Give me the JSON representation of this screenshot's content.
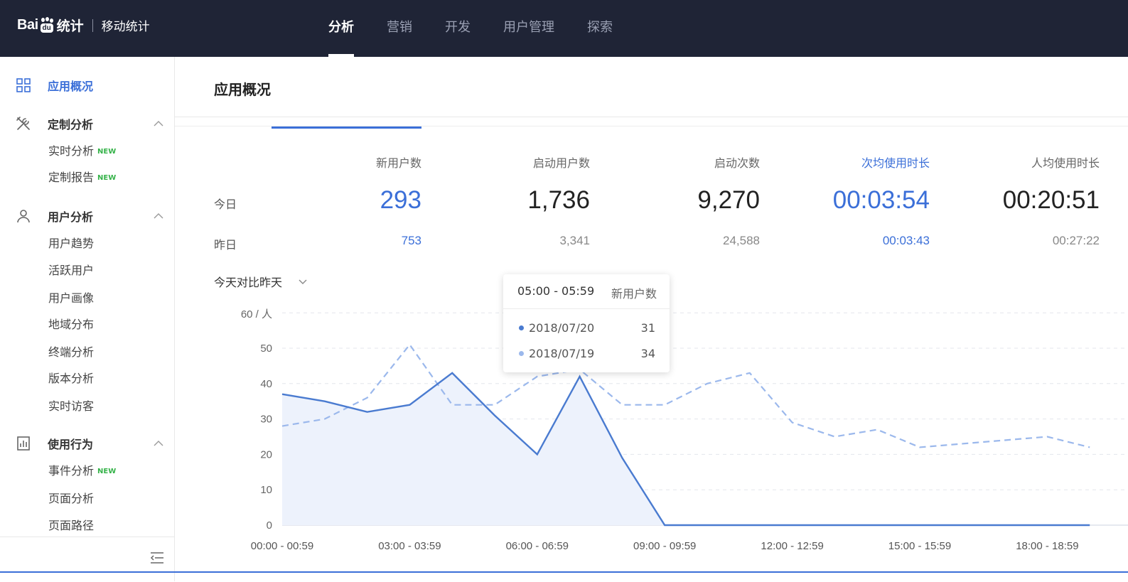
{
  "brand": {
    "logo_pre": "Bai",
    "logo_paw": "du",
    "logo_stat": "统计",
    "product": "移动统计"
  },
  "nav": [
    {
      "label": "分析",
      "active": true
    },
    {
      "label": "营销"
    },
    {
      "label": "开发"
    },
    {
      "label": "用户管理"
    },
    {
      "label": "探索"
    }
  ],
  "sidebar": {
    "overview": {
      "label": "应用概况",
      "icon": "grid-icon"
    },
    "groups": [
      {
        "label": "定制分析",
        "icon": "tools-icon",
        "items": [
          {
            "label": "实时分析",
            "badge": "NEW"
          },
          {
            "label": "定制报告",
            "badge": "NEW"
          }
        ]
      },
      {
        "label": "用户分析",
        "icon": "user-icon",
        "items": [
          {
            "label": "用户趋势"
          },
          {
            "label": "活跃用户"
          },
          {
            "label": "用户画像"
          },
          {
            "label": "地域分布"
          },
          {
            "label": "终端分析"
          },
          {
            "label": "版本分析"
          },
          {
            "label": "实时访客"
          }
        ]
      },
      {
        "label": "使用行为",
        "icon": "bar-chart-icon",
        "items": [
          {
            "label": "事件分析",
            "badge": "NEW"
          },
          {
            "label": "页面分析"
          },
          {
            "label": "页面路径"
          }
        ]
      }
    ],
    "collapse_icon": "collapse-menu-icon"
  },
  "page": {
    "title": "应用概况"
  },
  "metrics": {
    "row_today": "今日",
    "row_yesterday": "昨日",
    "columns": [
      {
        "label": "新用户数",
        "today": "293",
        "yesterday": "753",
        "highlight": true
      },
      {
        "label": "启动用户数",
        "today": "1,736",
        "yesterday": "3,341"
      },
      {
        "label": "启动次数",
        "today": "9,270",
        "yesterday": "24,588"
      },
      {
        "label": "次均使用时长",
        "today": "00:03:54",
        "yesterday": "00:03:43",
        "highlight": true
      },
      {
        "label": "人均使用时长",
        "today": "00:20:51",
        "yesterday": "00:27:22"
      }
    ]
  },
  "compare": {
    "label": "今天对比昨天"
  },
  "tooltip": {
    "time": "05:00 - 05:59",
    "metric": "新用户数",
    "rows": [
      {
        "date": "2018/07/20",
        "value": "31",
        "color": "#4a7bd0"
      },
      {
        "date": "2018/07/19",
        "value": "34",
        "color": "#9bb8ec"
      }
    ]
  },
  "colors": {
    "accent": "#3b6fd8",
    "today_line": "#4a7bd0",
    "yesterday_line": "#9bb8ec",
    "area_fill": "#edf2fc",
    "topbar": "#1f2436"
  },
  "chart_data": {
    "type": "area",
    "ylabel": "60 / 人",
    "ylim": [
      0,
      60
    ],
    "yticks": [
      "0",
      "10",
      "20",
      "30",
      "40",
      "50"
    ],
    "x": [
      "00:00 - 00:59",
      "01:00 - 01:59",
      "02:00 - 02:59",
      "03:00 - 03:59",
      "04:00 - 04:59",
      "05:00 - 05:59",
      "06:00 - 06:59",
      "07:00 - 07:59",
      "08:00 - 08:59",
      "09:00 - 09:59",
      "10:00 - 10:59",
      "11:00 - 11:59",
      "12:00 - 12:59",
      "13:00 - 13:59",
      "14:00 - 14:59",
      "15:00 - 15:59",
      "16:00 - 16:59",
      "17:00 - 17:59",
      "18:00 - 18:59",
      "19:00 - 19:59"
    ],
    "xtick_labels": [
      "00:00 - 00:59",
      "03:00 - 03:59",
      "06:00 - 06:59",
      "09:00 - 09:59",
      "12:00 - 12:59",
      "15:00 - 15:59",
      "18:00 - 18:59"
    ],
    "series": [
      {
        "name": "2018/07/20",
        "style": "solid-area",
        "values": [
          37,
          35,
          32,
          34,
          43,
          31,
          20,
          42,
          19,
          0,
          0,
          0,
          0,
          0,
          0,
          0,
          0,
          0,
          0,
          0
        ]
      },
      {
        "name": "2018/07/19",
        "style": "dashed",
        "values": [
          28,
          30,
          36,
          51,
          34,
          34,
          42,
          44,
          34,
          34,
          40,
          43,
          29,
          25,
          27,
          22,
          23,
          24,
          25,
          22
        ]
      }
    ],
    "grid": true,
    "legend": "none"
  }
}
